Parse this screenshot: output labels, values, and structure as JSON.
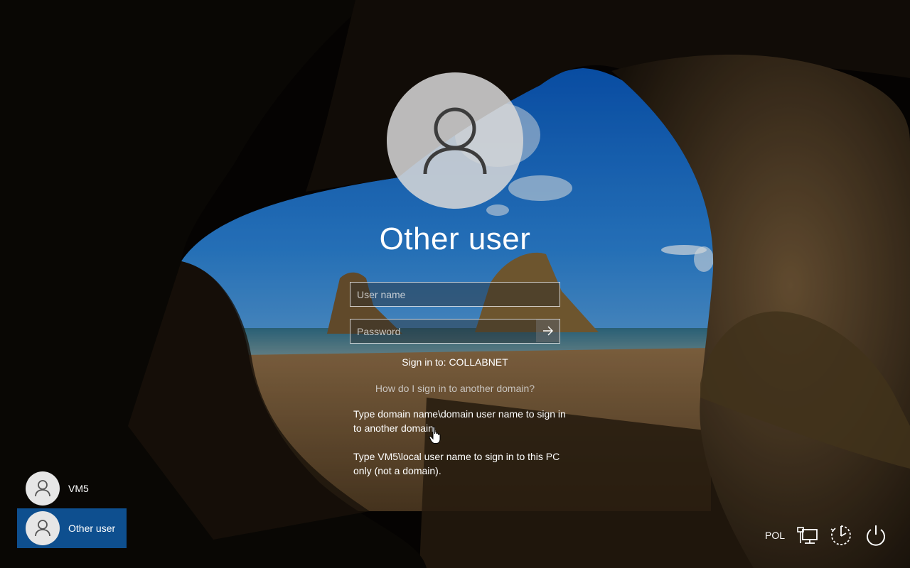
{
  "login": {
    "user_title": "Other user",
    "username_placeholder": "User name",
    "password_placeholder": "Password",
    "sign_in_to": "Sign in to: COLLABNET",
    "help_link": "How do I sign in to another domain?",
    "hint_domain": "Type domain name\\domain user name to sign in to another domain.",
    "hint_local": "Type VM5\\local user name to sign in to this PC only (not a domain)."
  },
  "user_switcher": {
    "users": [
      {
        "label": "VM5",
        "selected": false
      },
      {
        "label": "Other user",
        "selected": true
      }
    ]
  },
  "tray": {
    "language": "POL",
    "icons": [
      "network-icon",
      "ease-of-access-icon",
      "power-icon"
    ]
  },
  "colors": {
    "selected_tile": "#0e4f8f",
    "avatar_fill": "#d7d7d7"
  }
}
